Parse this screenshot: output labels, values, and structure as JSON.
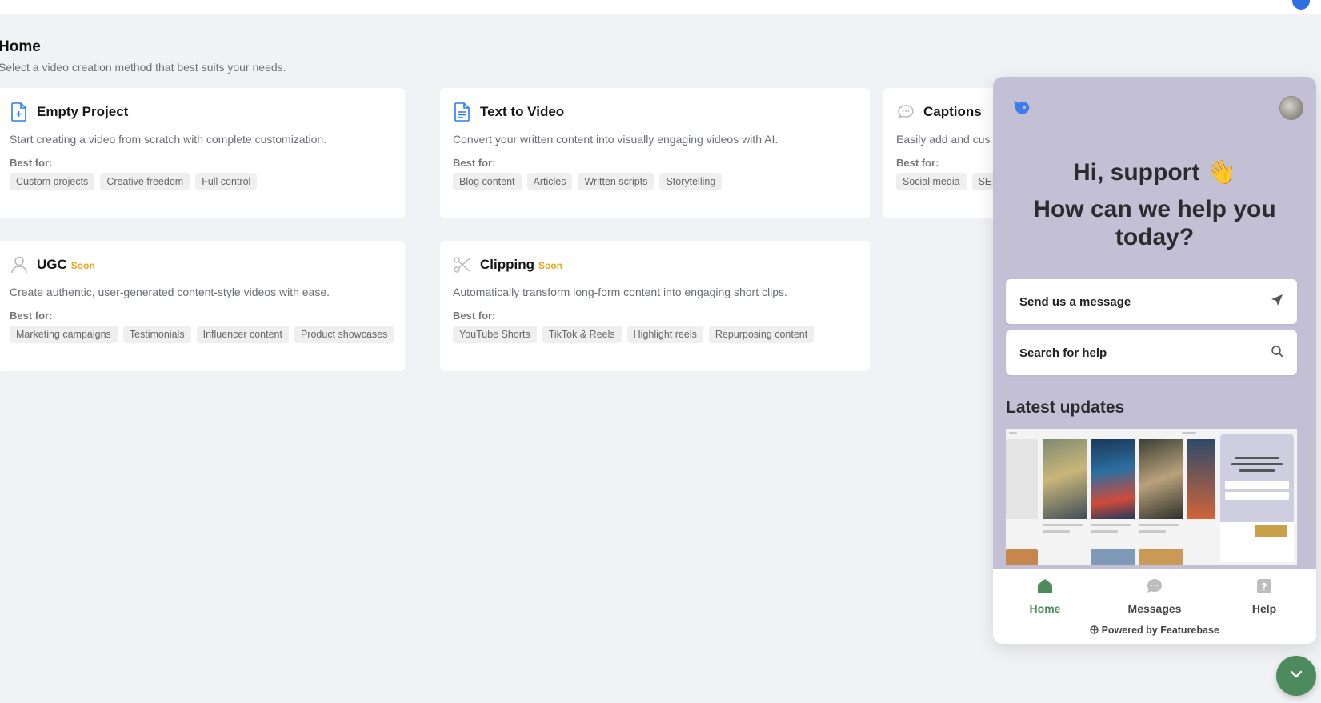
{
  "page": {
    "title": "Home",
    "subtitle": "Select a video creation method that best suits your needs."
  },
  "cards": [
    {
      "title": "Empty Project",
      "soon": "",
      "description": "Start creating a video from scratch with complete customization.",
      "best_for_label": "Best for:",
      "tags": [
        "Custom projects",
        "Creative freedom",
        "Full control"
      ],
      "icon": "file-plus-icon"
    },
    {
      "title": "Text to Video",
      "soon": "",
      "description": "Convert your written content into visually engaging videos with AI.",
      "best_for_label": "Best for:",
      "tags": [
        "Blog content",
        "Articles",
        "Written scripts",
        "Storytelling"
      ],
      "icon": "file-text-icon"
    },
    {
      "title": "Captions",
      "soon": "",
      "description": "Easily add and cus",
      "best_for_label": "Best for:",
      "tags": [
        "Social media",
        "SE"
      ],
      "icon": "chat-bubbles-icon"
    },
    {
      "title": "UGC",
      "soon": "Soon",
      "description": "Create authentic, user-generated content-style videos with ease.",
      "best_for_label": "Best for:",
      "tags": [
        "Marketing campaigns",
        "Testimonials",
        "Influencer content",
        "Product showcases"
      ],
      "icon": "user-icon"
    },
    {
      "title": "Clipping",
      "soon": "Soon",
      "description": "Automatically transform long-form content into engaging short clips.",
      "best_for_label": "Best for:",
      "tags": [
        "YouTube Shorts",
        "TikTok & Reels",
        "Highlight reels",
        "Repurposing content"
      ],
      "icon": "scissors-icon"
    }
  ],
  "widget": {
    "greeting": "Hi, support 👋",
    "headline": "How can we help you today?",
    "send_message": "Send us a message",
    "search_help": "Search for help",
    "latest_updates": "Latest updates",
    "tabs": {
      "home": "Home",
      "messages": "Messages",
      "help": "Help"
    },
    "powered_by": "Powered by Featurebase",
    "colors": {
      "header_bg": "#c3c0d6",
      "active_tab": "#4e8a5c"
    }
  },
  "scroll_button": {
    "icon": "chevron-down-icon"
  },
  "colors": {
    "accent": "#2f7bf0",
    "soon": "#e8a21a",
    "background": "#f1f2f5"
  }
}
